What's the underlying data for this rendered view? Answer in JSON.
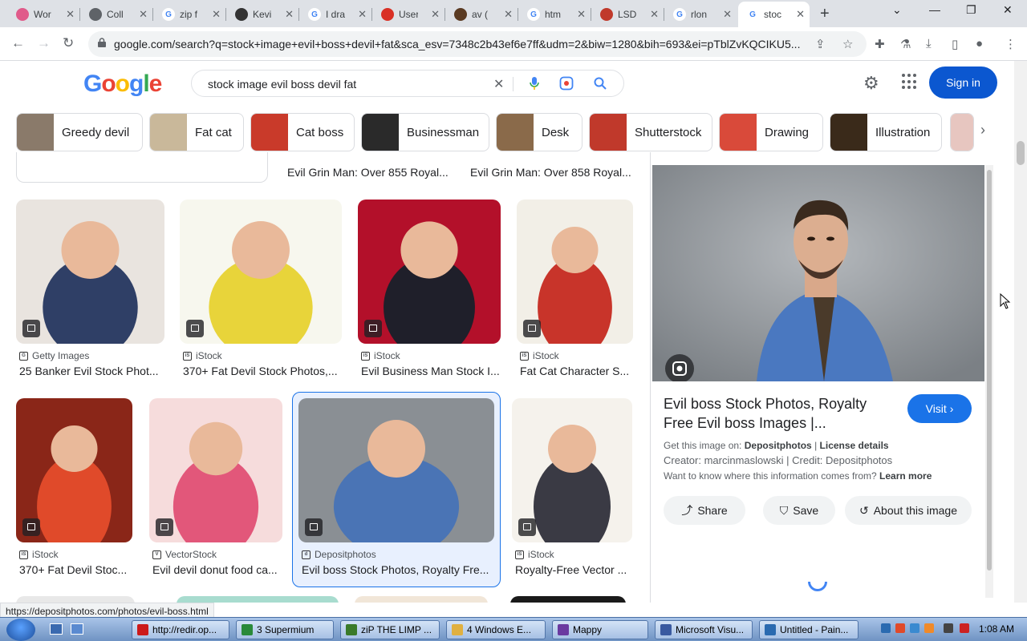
{
  "browser": {
    "tabs": [
      {
        "label": "Wor",
        "icon": "flower-icon",
        "color": "#e05a8a"
      },
      {
        "label": "Coll",
        "icon": "globe-icon",
        "color": "#5f6368"
      },
      {
        "label": "zip f",
        "icon": "google-icon",
        "color": "#4285f4"
      },
      {
        "label": "Kevi",
        "icon": "bug-icon",
        "color": "#333333"
      },
      {
        "label": "I dra",
        "icon": "google-icon",
        "color": "#4285f4"
      },
      {
        "label": "User",
        "icon": "flame-icon",
        "color": "#d93025"
      },
      {
        "label": "av (",
        "icon": "film-icon",
        "color": "#5a3a22"
      },
      {
        "label": "htm",
        "icon": "google-icon",
        "color": "#4285f4"
      },
      {
        "label": "LSD",
        "icon": "wave-icon",
        "color": "#c0392b"
      },
      {
        "label": "rlon",
        "icon": "google-icon",
        "color": "#4285f4"
      },
      {
        "label": "stoc",
        "icon": "google-icon",
        "color": "#4285f4",
        "active": true
      }
    ],
    "url": "google.com/search?q=stock+image+evil+boss+devil+fat&sca_esv=7348c2b43ef6e7ff&udm=2&biw=1280&bih=693&ei=pTblZvKQCIKU5..."
  },
  "header": {
    "logo": "Google",
    "query": "stock image evil boss devil fat",
    "signin_label": "Sign in"
  },
  "chips": [
    {
      "label": "Greedy devil",
      "thumb": "#8a7a6a"
    },
    {
      "label": "Fat cat",
      "thumb": "#c9b89a"
    },
    {
      "label": "Cat boss",
      "thumb": "#c93a2a"
    },
    {
      "label": "Businessman",
      "thumb": "#2a2a2a"
    },
    {
      "label": "Desk",
      "thumb": "#8a6a4a"
    },
    {
      "label": "Shutterstock",
      "thumb": "#c0392b"
    },
    {
      "label": "Drawing",
      "thumb": "#d94a3a"
    },
    {
      "label": "Illustration",
      "thumb": "#3a2a1a"
    }
  ],
  "partial_row": {
    "titles": [
      "Evil Grin Man: Over 855 Royal...",
      "Evil Grin Man: Over 858 Royal..."
    ]
  },
  "results": [
    {
      "source": "Getty Images",
      "source_icon": "G",
      "title": "25 Banker Evil Stock Phot...",
      "bg": "#e9e4df",
      "fg": "#2f3f66"
    },
    {
      "source": "iStock",
      "source_icon": "iS",
      "title": "370+ Fat Devil Stock Photos,...",
      "bg": "#f7f7ee",
      "fg": "#e8d43a"
    },
    {
      "source": "iStock",
      "source_icon": "iS",
      "title": "Evil Business Man Stock I...",
      "bg": "#b3102a",
      "fg": "#1f1f2a"
    },
    {
      "source": "iStock",
      "source_icon": "iS",
      "title": "Fat Cat Character S...",
      "bg": "#f2efe7",
      "fg": "#c8342a"
    },
    {
      "source": "iStock",
      "source_icon": "iS",
      "title": "370+ Fat Devil Stoc...",
      "bg": "#8a2618",
      "fg": "#e04a2a"
    },
    {
      "source": "VectorStock",
      "source_icon": "V",
      "title": "Evil devil donut food ca...",
      "bg": "#f6dcdc",
      "fg": "#e2577a"
    },
    {
      "source": "Depositphotos",
      "source_icon": "d",
      "title": "Evil boss Stock Photos, Royalty Fre...",
      "bg": "#8a8f94",
      "fg": "#4a74b5"
    },
    {
      "source": "iStock",
      "source_icon": "iS",
      "title": "Royalty-Free Vector ...",
      "bg": "#f5f2ec",
      "fg": "#3a3a44"
    }
  ],
  "panel": {
    "title": "Evil boss Stock Photos, Royalty Free Evil boss Images |...",
    "visit_label": "Visit",
    "get_image_prefix": "Get this image on:",
    "get_image_source": "Depositphotos",
    "license_label": "License details",
    "creator_line": "Creator: marcinmaslowski | Credit: Depositphotos",
    "info_question": "Want to know where this information comes from?",
    "learn_more": "Learn more",
    "share_label": "Share",
    "save_label": "Save",
    "about_label": "About this image"
  },
  "status_url": "https://depositphotos.com/photos/evil-boss.html",
  "taskbar": {
    "items": [
      {
        "label": "http://redir.op...",
        "color": "#cc1a1a"
      },
      {
        "label": "3 Supermium",
        "color": "#2a8a3a"
      },
      {
        "label": "ziP THE LIMP ...",
        "color": "#3a7a2a"
      },
      {
        "label": "4 Windows E...",
        "color": "#e0b040"
      },
      {
        "label": "Mappy",
        "color": "#6a3aa0"
      },
      {
        "label": "Microsoft Visu...",
        "color": "#3a5aa0"
      },
      {
        "label": "Untitled - Pain...",
        "color": "#2a6ab0"
      }
    ],
    "clock": "1:08 AM"
  }
}
